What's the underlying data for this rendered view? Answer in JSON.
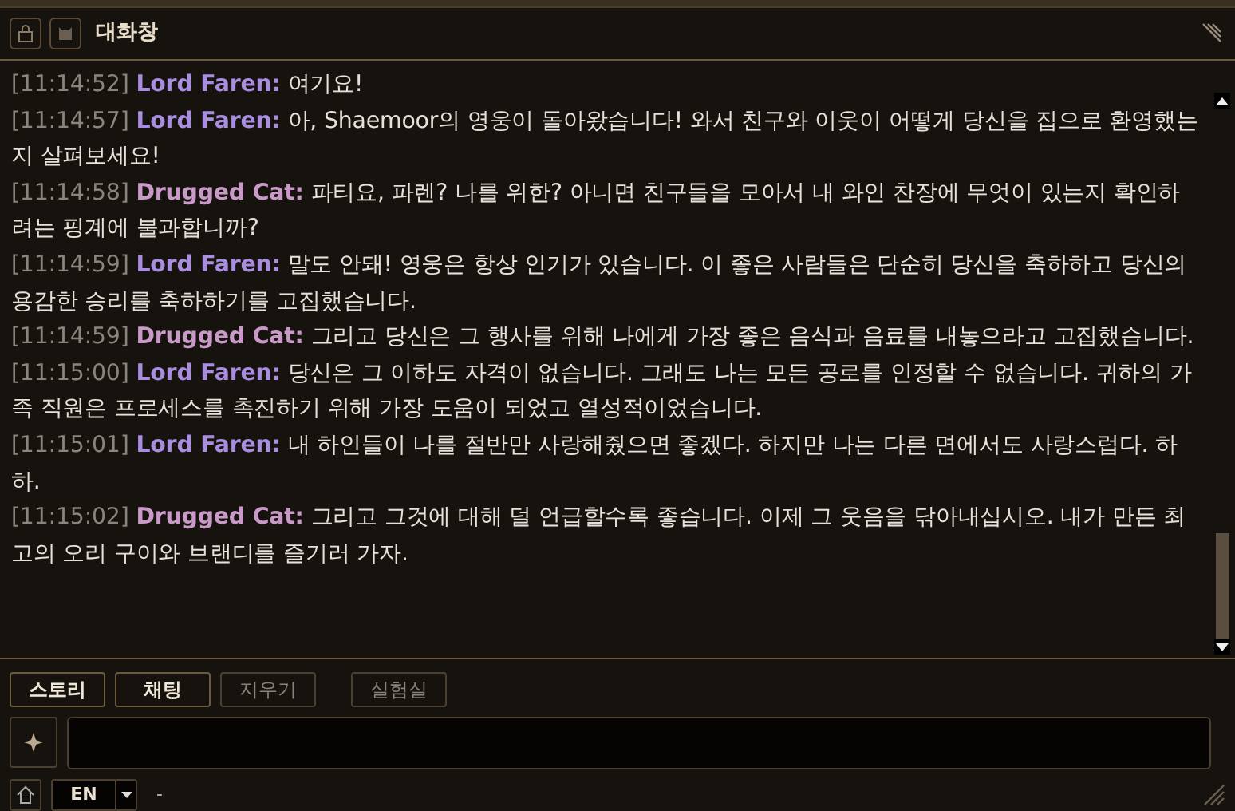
{
  "window": {
    "title": "대화창"
  },
  "messages": [
    {
      "time": "[11:14:52]",
      "speaker": "Lord Faren:",
      "color": "#a98ee0",
      "text": "여기요!"
    },
    {
      "time": "[11:14:57]",
      "speaker": "Lord Faren:",
      "color": "#a98ee0",
      "text": "아, Shaemoor의 영웅이 돌아왔습니다! 와서 친구와 이웃이 어떻게 당신을 집으로 환영했는지 살펴보세요!"
    },
    {
      "time": "[11:14:58]",
      "speaker": "Drugged Cat:",
      "color": "#c99ac8",
      "text": "파티요, 파렌? 나를 위한? 아니면 친구들을 모아서 내 와인 찬장에 무엇이 있는지 확인하려는 핑계에 불과합니까?"
    },
    {
      "time": "[11:14:59]",
      "speaker": "Lord Faren:",
      "color": "#a98ee0",
      "text": "말도 안돼! 영웅은 항상 인기가 있습니다. 이 좋은 사람들은 단순히 당신을 축하하고 당신의 용감한 승리를 축하하기를 고집했습니다."
    },
    {
      "time": "[11:14:59]",
      "speaker": "Drugged Cat:",
      "color": "#c99ac8",
      "text": "그리고 당신은 그 행사를 위해 나에게 가장 좋은 음식과 음료를 내놓으라고 고집했습니다."
    },
    {
      "time": "[11:15:00]",
      "speaker": "Lord Faren:",
      "color": "#a98ee0",
      "text": "당신은 그 이하도 자격이 없습니다. 그래도 나는 모든 공로를 인정할 수 없습니다. 귀하의 가족 직원은 프로세스를 촉진하기 위해 가장 도움이 되었고 열성적이었습니다."
    },
    {
      "time": "[11:15:01]",
      "speaker": "Lord Faren:",
      "color": "#a98ee0",
      "text": "내 하인들이 나를 절반만 사랑해줬으면 좋겠다. 하지만 나는 다른 면에서도 사랑스럽다. 하하."
    },
    {
      "time": "[11:15:02]",
      "speaker": "Drugged Cat:",
      "color": "#c99ac8",
      "text": "그리고 그것에 대해 덜 언급할수록 좋습니다. 이제 그 웃음을 닦아내십시오. 내가 만든 최고의 오리 구이와 브랜디를 즐기러 가자."
    }
  ],
  "filters": [
    {
      "label": "스토리",
      "on": true
    },
    {
      "label": "채팅",
      "on": true
    },
    {
      "label": "지우기",
      "on": false
    },
    {
      "label": "실험실",
      "on": false
    }
  ],
  "language": {
    "value": "EN"
  },
  "status": "-"
}
